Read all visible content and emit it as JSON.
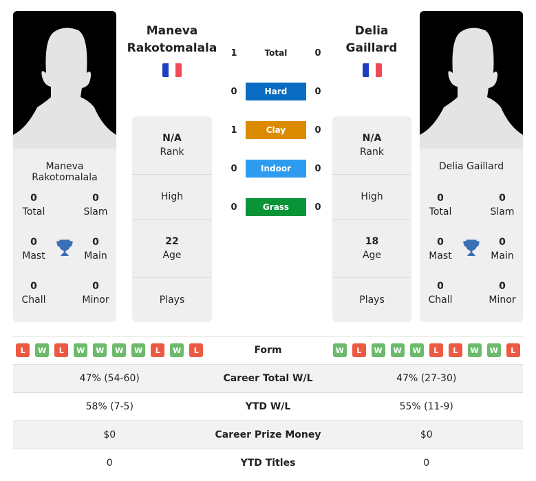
{
  "player1": {
    "name_line1": "Maneva",
    "name_line2": "Rakotomalala",
    "full_name": "Maneva Rakotomalala",
    "flag_colors": [
      "#1e3fbf",
      "#ffffff",
      "#ef4a57"
    ],
    "titles": {
      "total": {
        "value": "0",
        "label": "Total"
      },
      "slam": {
        "value": "0",
        "label": "Slam"
      },
      "mast": {
        "value": "0",
        "label": "Mast"
      },
      "main": {
        "value": "0",
        "label": "Main"
      },
      "chall": {
        "value": "0",
        "label": "Chall"
      },
      "minor": {
        "value": "0",
        "label": "Minor"
      }
    },
    "info": {
      "rank": {
        "value": "N/A",
        "label": "Rank"
      },
      "high": {
        "label": "High"
      },
      "age": {
        "value": "22",
        "label": "Age"
      },
      "plays": {
        "label": "Plays"
      }
    },
    "form": [
      "L",
      "W",
      "L",
      "W",
      "W",
      "W",
      "W",
      "L",
      "W",
      "L"
    ],
    "career_total_wl": "47% (54-60)",
    "ytd_wl": "58% (7-5)",
    "career_prize_money": "$0",
    "ytd_titles": "0"
  },
  "player2": {
    "name_line1": "Delia",
    "name_line2": "Gaillard",
    "full_name": "Delia Gaillard",
    "flag_colors": [
      "#1e3fbf",
      "#ffffff",
      "#ef4a57"
    ],
    "titles": {
      "total": {
        "value": "0",
        "label": "Total"
      },
      "slam": {
        "value": "0",
        "label": "Slam"
      },
      "mast": {
        "value": "0",
        "label": "Mast"
      },
      "main": {
        "value": "0",
        "label": "Main"
      },
      "chall": {
        "value": "0",
        "label": "Chall"
      },
      "minor": {
        "value": "0",
        "label": "Minor"
      }
    },
    "info": {
      "rank": {
        "value": "N/A",
        "label": "Rank"
      },
      "high": {
        "label": "High"
      },
      "age": {
        "value": "18",
        "label": "Age"
      },
      "plays": {
        "label": "Plays"
      }
    },
    "form": [
      "W",
      "L",
      "W",
      "W",
      "W",
      "L",
      "L",
      "W",
      "W",
      "L"
    ],
    "career_total_wl": "47% (27-30)",
    "ytd_wl": "55% (11-9)",
    "career_prize_money": "$0",
    "ytd_titles": "0"
  },
  "h2h": [
    {
      "label": "Total",
      "p1": "1",
      "p2": "0",
      "color": null
    },
    {
      "label": "Hard",
      "p1": "0",
      "p2": "0",
      "color": "#0a6bc2"
    },
    {
      "label": "Clay",
      "p1": "1",
      "p2": "0",
      "color": "#dc8b00"
    },
    {
      "label": "Indoor",
      "p1": "0",
      "p2": "0",
      "color": "#2d9cf0"
    },
    {
      "label": "Grass",
      "p1": "0",
      "p2": "0",
      "color": "#0a9438"
    }
  ],
  "table_labels": {
    "form": "Form",
    "career_total_wl": "Career Total W/L",
    "ytd_wl": "YTD W/L",
    "career_prize_money": "Career Prize Money",
    "ytd_titles": "YTD Titles"
  },
  "colors": {
    "win": "#6cbb6c",
    "loss": "#ec5a43",
    "trophy": "#3a6fb5"
  }
}
